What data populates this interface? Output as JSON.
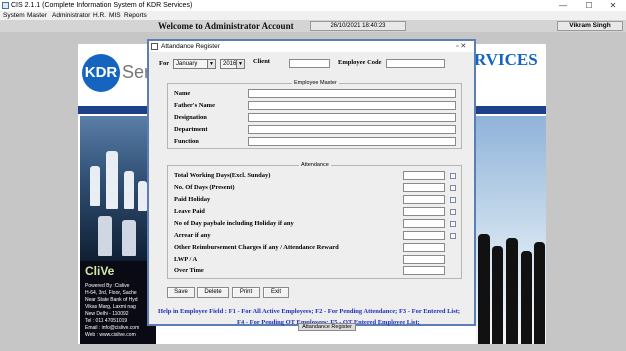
{
  "window": {
    "title": "CIS 2.1.1 (Complete Information System of KDR Services)",
    "minimize": "—",
    "maximize": "☐",
    "close": "✕"
  },
  "menu": [
    "System",
    "Master",
    "Administrator",
    "H.R.",
    "MIS",
    "Reports"
  ],
  "header": {
    "welcome": "Welcome to Administrator Account",
    "datetime": "26/10/2021   18:40:23",
    "user": "Vikram Singh"
  },
  "background": {
    "kdr_logo": "KDR",
    "kdr_serv": "Serv",
    "services": "RVICES",
    "clive": "CliVe",
    "info_lines": [
      "Powered By :Cislive",
      "H-64, 3rd, Floor, Sache",
      "Near State Bank of Hyd",
      "Vikas Marg, Laxmi nag",
      "New Delhi - 110092",
      "Tel    :  011 47051019",
      "Email : info@cislive.com",
      "Web  :  www.cislive.com"
    ]
  },
  "dialog": {
    "title": "Attandance Register",
    "controls": "▫ ✕",
    "for_label": "For",
    "month": "January",
    "year": "2016",
    "client_label": "Client",
    "client_value": "",
    "employee_code_label": "Employee Code",
    "employee_code_value": "",
    "employee_master": {
      "legend": "Employee Master",
      "fields": [
        "Name",
        "Father's Name",
        "Designation",
        "Department",
        "Function"
      ]
    },
    "attendance": {
      "legend": "Attendance",
      "fields": [
        "Total Working Days(Excl. Sunday)",
        "No. Of Days (Present)",
        "Paid Holiday",
        "Leave Paid",
        "No of Day paybale including Holiday if any",
        "Arrear if any",
        "Other Reimbursement Charges if any / Attendance Reward",
        "LWP / A",
        "Over Time"
      ]
    },
    "buttons": [
      "Save",
      "Delete",
      "Print",
      "Exit"
    ],
    "help_line1": "Help in Employee Field : F1 - For All Active Employees; F2 - For Pending Attendance; F3 - For Entered List;",
    "help_line2": "F4 - For Pending OT Employees; F5 - OT Entered Employee List;"
  },
  "taskbar_tooltip": "Attandance Register"
}
